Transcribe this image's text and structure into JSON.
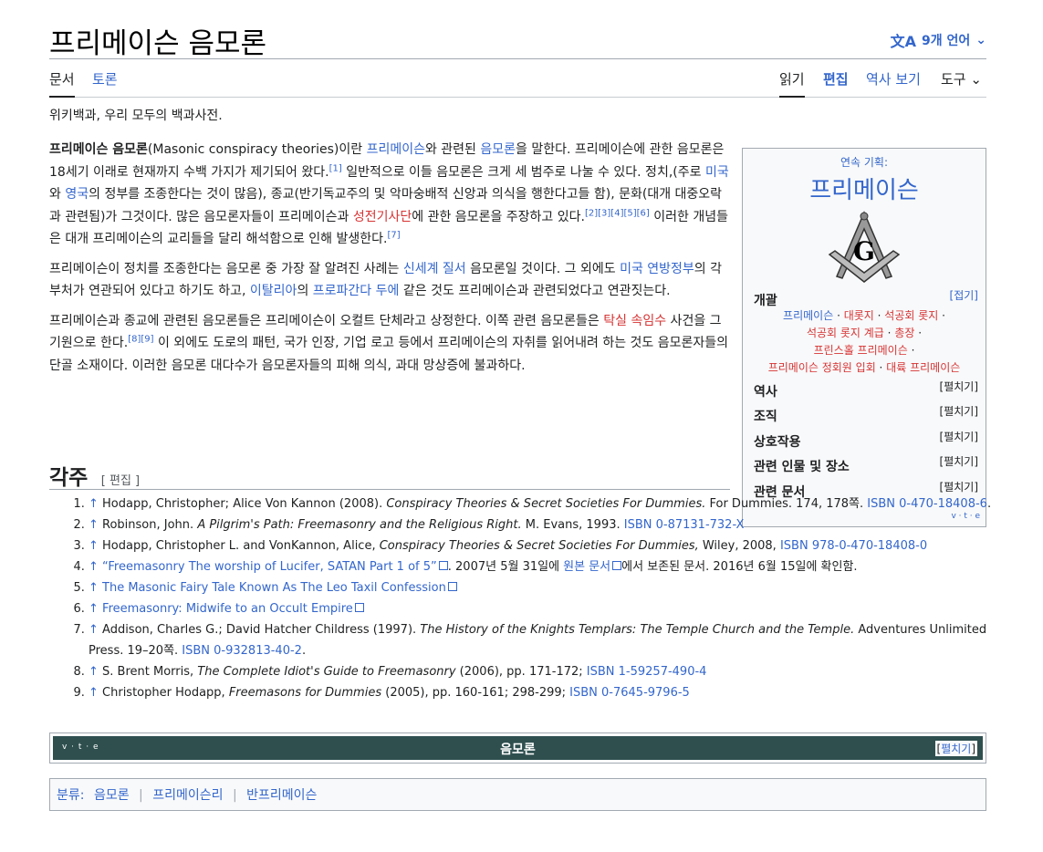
{
  "page": {
    "title": "프리메이슨 음모론",
    "languages": "9개 언어",
    "tagline": "위키백과, 우리 모두의 백과사전."
  },
  "tabs": {
    "article": "문서",
    "talk": "토론",
    "read": "읽기",
    "edit": "편집",
    "history": "역사 보기",
    "tools": "도구"
  },
  "body": {
    "p1": [
      {
        "t": "프리메이슨 음모론",
        "b": true
      },
      {
        "t": "(Masonic conspiracy theories)이란 "
      },
      {
        "t": "프리메이슨",
        "l": true
      },
      {
        "t": "와 관련된 "
      },
      {
        "t": "음모론",
        "l": true
      },
      {
        "t": "을 말한다. 프리메이슨에 관한 음모론은 18세기 이래로 현재까지 수백 가지가 제기되어 왔다."
      },
      {
        "t": "[1]",
        "s": true
      },
      {
        "t": " 일반적으로 이들 음모론은 크게 세 범주로 나눌 수 있다. 정치,(주로 "
      },
      {
        "t": "미국",
        "l": true
      },
      {
        "t": "와 "
      },
      {
        "t": "영국",
        "l": true
      },
      {
        "t": "의 정부를 조종한다는 것이 많음), 종교(반기독교주의 및 악마숭배적 신앙과 의식을 행한다고들 함), 문화(대개 대중오락과 관련됨)가 그것이다. 많은 음모론자들이 프리메이슨과 "
      },
      {
        "t": "성전기사단",
        "r": true
      },
      {
        "t": "에 관한 음모론을 주장하고 있다."
      },
      {
        "t": "[2][3][4][5][6]",
        "s": true
      },
      {
        "t": " 이러한 개념들은 대개 프리메이슨의 교리들을 달리 해석함으로 인해 발생한다."
      },
      {
        "t": "[7]",
        "s": true
      }
    ],
    "p2": [
      {
        "t": "프리메이슨이 정치를 조종한다는 음모론 중 가장 잘 알려진 사례는 "
      },
      {
        "t": "신세계 질서",
        "l": true
      },
      {
        "t": " 음모론일 것이다. 그 외에도 "
      },
      {
        "t": "미국 연방정부",
        "l": true
      },
      {
        "t": "의 각 부처가 연관되어 있다고 하기도 하고, "
      },
      {
        "t": "이탈리아",
        "l": true
      },
      {
        "t": "의 "
      },
      {
        "t": "프로파간다 두에",
        "l": true
      },
      {
        "t": " 같은 것도 프리메이슨과 관련되었다고 연관짓는다."
      }
    ],
    "p3": [
      {
        "t": "프리메이슨과 종교에 관련된 음모론들은 프리메이슨이 오컬트 단체라고 상정한다. 이쪽 관련 음모론들은 "
      },
      {
        "t": "탁실 속임수",
        "r": true
      },
      {
        "t": " 사건을 그 기원으로 한다."
      },
      {
        "t": "[8][9]",
        "s": true
      },
      {
        "t": " 이 외에도 도로의 패턴, 국가 인장, 기업 로고 등에서 프리메이슨의 자취를 읽어내려 하는 것도 음모론자들의 단골 소재이다. 이러한 음모론 대다수가 음모론자들의 피해 의식, 과대 망상증에 불과하다."
      }
    ]
  },
  "infobox": {
    "pre": "연속 기획:",
    "title": "프리메이슨",
    "overview": "개괄",
    "collapse": "[접기]",
    "links": [
      [
        {
          "t": "프리메이슨",
          "l": true
        },
        {
          "t": " · "
        },
        {
          "t": "대롯지",
          "r": true
        },
        {
          "t": " · "
        },
        {
          "t": "석공회 롯지",
          "r": true
        },
        {
          "t": " ·"
        }
      ],
      [
        {
          "t": "석공회 롯지 계급",
          "r": true
        },
        {
          "t": " · "
        },
        {
          "t": "총장",
          "r": true
        },
        {
          "t": " ·"
        }
      ],
      [
        {
          "t": "프린스홀 프리메이슨",
          "r": true
        },
        {
          "t": " ·"
        }
      ],
      [
        {
          "t": "프리메이슨 정회원 입회",
          "r": true
        },
        {
          "t": " · "
        },
        {
          "t": "대륙 프리메이슨",
          "r": true
        }
      ]
    ],
    "sections": [
      {
        "label": "역사",
        "toggle": "[펼치기]"
      },
      {
        "label": "조직",
        "toggle": "[펼치기]"
      },
      {
        "label": "상호작용",
        "toggle": "[펼치기]"
      },
      {
        "label": "관련 인물 및 장소",
        "toggle": "[펼치기]"
      },
      {
        "label": "관련 문서",
        "toggle": "[펼치기]"
      }
    ],
    "vte": "v · t · e"
  },
  "refs": {
    "heading": "각주",
    "edit": "[ 편집 ]",
    "items": [
      [
        {
          "t": "↑ ",
          "l": true
        },
        {
          "t": "Hodapp, Christopher; Alice Von Kannon (2008). "
        },
        {
          "t": "Conspiracy Theories & Secret Societies For Dummies.",
          "i": true
        },
        {
          "t": " For Dummies. 174, 178쪽. "
        },
        {
          "t": "ISBN 0-470-18408-6",
          "l": true
        },
        {
          "t": "."
        }
      ],
      [
        {
          "t": "↑ ",
          "l": true
        },
        {
          "t": "Robinson, John. "
        },
        {
          "t": "A Pilgrim's Path: Freemasonry and the Religious Right.",
          "i": true
        },
        {
          "t": " M. Evans, 1993. "
        },
        {
          "t": "ISBN 0-87131-732-X",
          "l": true
        }
      ],
      [
        {
          "t": "↑ ",
          "l": true
        },
        {
          "t": "Hodapp, Christopher L. and VonKannon, Alice, "
        },
        {
          "t": "Conspiracy Theories & Secret Societies For Dummies,",
          "i": true
        },
        {
          "t": " Wiley, 2008, "
        },
        {
          "t": "ISBN 978-0-470-18408-0",
          "l": true
        }
      ],
      [
        {
          "t": "↑ ",
          "l": true
        },
        {
          "t": "“Freemasonry The worship of Lucifer, SATAN Part 1 of 5”",
          "l": true,
          "e": true
        },
        {
          "t": ". 2007년 5월 31일에 "
        },
        {
          "t": "원본 문서",
          "l": true,
          "e": true
        },
        {
          "t": "에서 보존된 문서. 2016년 6월 15일에 확인함."
        }
      ],
      [
        {
          "t": "↑ ",
          "l": true
        },
        {
          "t": "The Masonic Fairy Tale Known As The Leo Taxil Confession",
          "l": true,
          "e": true
        }
      ],
      [
        {
          "t": "↑ ",
          "l": true
        },
        {
          "t": "Freemasonry: Midwife to an Occult Empire",
          "l": true,
          "e": true
        }
      ],
      [
        {
          "t": "↑ ",
          "l": true
        },
        {
          "t": "Addison, Charles G.; David Hatcher Childress (1997). "
        },
        {
          "t": "The History of the Knights Templars: The Temple Church and the Temple.",
          "i": true
        },
        {
          "t": " Adventures Unlimited Press. 19–20쪽. "
        },
        {
          "t": "ISBN 0-932813-40-2",
          "l": true
        },
        {
          "t": "."
        }
      ],
      [
        {
          "t": "↑ ",
          "l": true
        },
        {
          "t": "S. Brent Morris, "
        },
        {
          "t": "The Complete Idiot's Guide to Freemasonry",
          "i": true
        },
        {
          "t": " (2006), pp. 171-172; "
        },
        {
          "t": "ISBN 1-59257-490-4",
          "l": true
        }
      ],
      [
        {
          "t": "↑ ",
          "l": true
        },
        {
          "t": "Christopher Hodapp, "
        },
        {
          "t": "Freemasons for Dummies",
          "i": true
        },
        {
          "t": " (2005), pp. 160-161; 298-299; "
        },
        {
          "t": "ISBN 0-7645-9796-5",
          "l": true
        }
      ]
    ]
  },
  "navbox": {
    "vte": "v · t · e",
    "title": "음모론",
    "toggle_open": "[",
    "toggle": "펼치기",
    "toggle_close": "]"
  },
  "categories": {
    "label": "분류:",
    "items": [
      "음모론",
      "프리메이슨리",
      "반프리메이슨"
    ]
  },
  "colors": {
    "link": "#3366cc",
    "redlink": "#d73333",
    "navbox_header": "#2f4f4f"
  }
}
